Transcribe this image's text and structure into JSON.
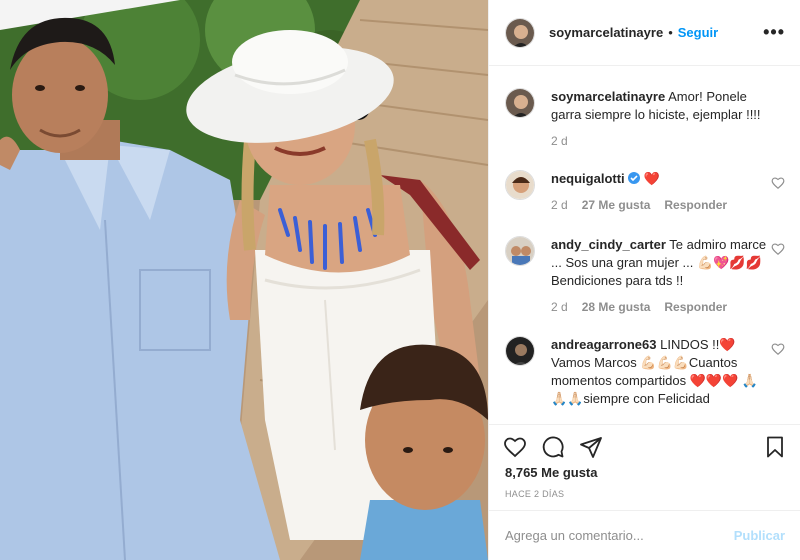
{
  "post": {
    "username": "soymarcelatinayre",
    "follow_label": "Seguir",
    "dot": "•",
    "more_icon": "more-options-icon",
    "more_text": "•••"
  },
  "caption": {
    "username": "soymarcelatinayre",
    "text": "Amor! Ponele garra siempre lo hiciste, ejemplar !!!!",
    "time": "2 d"
  },
  "comments": [
    {
      "username": "nequigalotti",
      "verified": true,
      "text": "❤️",
      "time": "2 d",
      "likes": "27 Me gusta",
      "reply": "Responder"
    },
    {
      "username": "andy_cindy_carter",
      "verified": false,
      "text": "Te admiro marce ... Sos una gran mujer ... 💪🏻💖💋💋Bendiciones para tds !!",
      "time": "2 d",
      "likes": "28 Me gusta",
      "reply": "Responder"
    },
    {
      "username": "andreagarrone63",
      "verified": false,
      "text": "LINDOS !!❤️ Vamos Marcos 💪🏻💪🏻💪🏻Cuantos momentos compartidos ❤️❤️❤️ 🙏🏻🙏🏻🙏🏻siempre con Felicidad",
      "time": "",
      "likes": "",
      "reply": ""
    }
  ],
  "actions": {
    "like_icon": "heart-icon",
    "comment_icon": "comment-icon",
    "share_icon": "share-icon",
    "save_icon": "bookmark-icon"
  },
  "likes_count": "8,765 Me gusta",
  "posted_ago": "HACE 2 DÍAS",
  "add_comment": {
    "placeholder": "Agrega un comentario...",
    "publish_label": "Publicar"
  },
  "colors": {
    "accent": "#0095f6",
    "publish_disabled": "#b2dffc",
    "muted": "#8e8e8e",
    "border": "#efefef",
    "heart": "#ed4956"
  }
}
